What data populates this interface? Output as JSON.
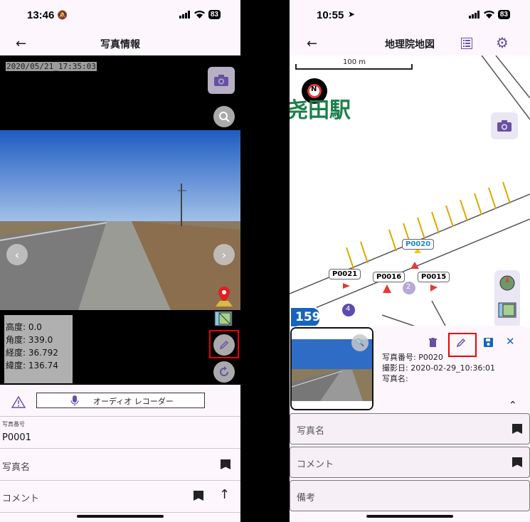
{
  "left": {
    "status": {
      "time": "13:46",
      "battery": "83"
    },
    "title": "写真情報",
    "timestamp": "2020/05/21_17:35:03",
    "info": {
      "altitude": "高度: 0.0",
      "angle": "角度: 339.0",
      "longitude": "経度: 36.792",
      "latitude": "緯度: 136.74"
    },
    "audio_label": "オーディオ レコーダー",
    "photo_number_label": "写真番号",
    "photo_number_value": "P0001",
    "photo_name_label": "写真名",
    "comment_label": "コメント"
  },
  "right": {
    "status": {
      "time": "10:55",
      "battery": "83"
    },
    "title": "地理院地図",
    "scale": "100 m",
    "station": "尧田駅",
    "route": "159",
    "markers": [
      "P0020",
      "P0021",
      "P0016",
      "P0015"
    ],
    "circle_nums": [
      "2",
      "4"
    ],
    "detail": {
      "number": "写真番号: P0020",
      "date": "撮影日: 2020-02-29_10:36:01",
      "name": "写真名:"
    },
    "fields": {
      "photo_name": "写真名",
      "comment": "コメント",
      "notes": "備考"
    }
  },
  "colors": {
    "accent": "#6750a4",
    "highlight": "#e00000",
    "blue": "#1565c0"
  }
}
